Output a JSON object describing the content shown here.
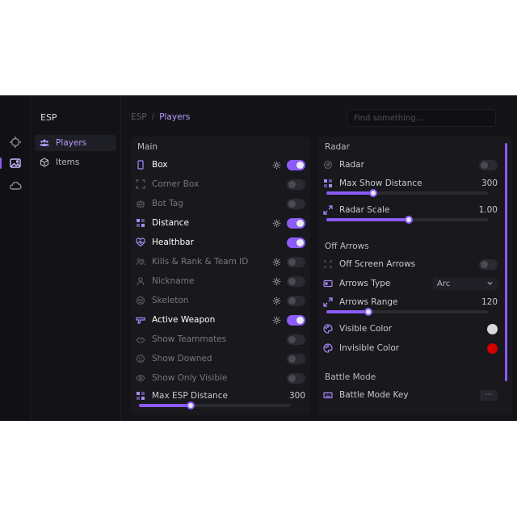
{
  "panel": {
    "title": "ESP",
    "nav": [
      {
        "label": "Players",
        "icon": "users-icon",
        "active": true
      },
      {
        "label": "Items",
        "icon": "box-icon",
        "active": false
      }
    ]
  },
  "breadcrumb": {
    "root": "ESP",
    "separator": "/",
    "current": "Players"
  },
  "search": {
    "placeholder": "Find something..."
  },
  "main": {
    "title": "Main",
    "rows": [
      {
        "label": "Box",
        "enabled": true,
        "gear": true,
        "icon": "phone-icon"
      },
      {
        "label": "Corner Box",
        "enabled": false,
        "gear": false,
        "icon": "corner-icon"
      },
      {
        "label": "Bot Tag",
        "enabled": false,
        "gear": false,
        "icon": "bot-icon"
      },
      {
        "label": "Distance",
        "enabled": true,
        "gear": true,
        "icon": "distance-icon"
      },
      {
        "label": "Healthbar",
        "enabled": true,
        "gear": false,
        "icon": "heart-pulse-icon"
      },
      {
        "label": "Kills & Rank & Team ID",
        "enabled": false,
        "gear": true,
        "icon": "team-icon"
      },
      {
        "label": "Nickname",
        "enabled": false,
        "gear": true,
        "icon": "user-icon"
      },
      {
        "label": "Skeleton",
        "enabled": false,
        "gear": true,
        "icon": "skull-icon"
      },
      {
        "label": "Active Weapon",
        "enabled": true,
        "gear": true,
        "icon": "gun-icon"
      },
      {
        "label": "Show Teammates",
        "enabled": false,
        "gear": false,
        "icon": "hands-icon"
      },
      {
        "label": "Show Downed",
        "enabled": false,
        "gear": false,
        "icon": "downed-icon"
      },
      {
        "label": "Show Only Visible",
        "enabled": false,
        "gear": false,
        "icon": "eye-icon"
      }
    ],
    "max_distance": {
      "label": "Max ESP Distance",
      "value": "300",
      "fill": 0.34
    }
  },
  "radar": {
    "title": "Radar",
    "toggle": {
      "label": "Radar",
      "enabled": false
    },
    "max_show_distance": {
      "label": "Max Show Distance",
      "value": "300",
      "fill": 0.29
    },
    "radar_scale": {
      "label": "Radar Scale",
      "value": "1.00",
      "fill": 0.51
    }
  },
  "off_arrows": {
    "title": "Off Arrows",
    "toggle": {
      "label": "Off Screen Arrows",
      "enabled": false
    },
    "arrows_type": {
      "label": "Arrows Type",
      "value": "Arc"
    },
    "arrows_range": {
      "label": "Arrows Range",
      "value": "120",
      "fill": 0.26
    },
    "visible_color": {
      "label": "Visible Color",
      "color": "#d8d8d8"
    },
    "invisible_color": {
      "label": "Invisible Color",
      "color": "#d40000"
    }
  },
  "battle_mode": {
    "title": "Battle Mode",
    "key": {
      "label": "Battle Mode Key",
      "button": "···"
    }
  },
  "accent": "#8b5cf6"
}
